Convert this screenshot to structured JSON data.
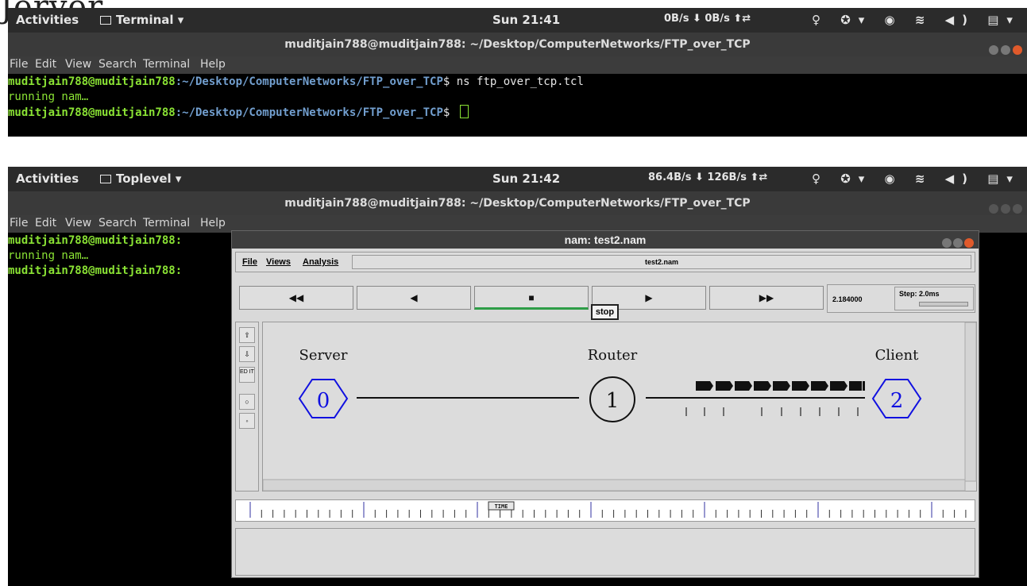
{
  "heading_fragment": "Jerver.",
  "shot1": {
    "topbar": {
      "activities": "Activities",
      "app": "Terminal ▾",
      "clock": "Sun 21:41",
      "net": "0B/s ⬇   0B/s ⬆⇄",
      "status_icons": "♀ ✪▾ ◉ ≋ ◀) ▤▾"
    },
    "window_title": "muditjain788@muditjain788: ~/Desktop/ComputerNetworks/FTP_over_TCP",
    "menu": [
      "File",
      "Edit",
      "View",
      "Search",
      "Terminal",
      "Help"
    ],
    "terminal": {
      "user_host": "muditjain788@muditjain788",
      "path": ":~/Desktop/ComputerNetworks/FTP_over_TCP",
      "prompt": "$ ",
      "command": "ns ftp_over_tcp.tcl",
      "output": "running nam…"
    }
  },
  "shot2": {
    "topbar": {
      "activities": "Activities",
      "app": "Toplevel ▾",
      "clock": "Sun 21:42",
      "net": "86.4B/s ⬇  126B/s ⬆⇄",
      "status_icons": "♀ ✪▾ ◉ ≋ ◀) ▤▾"
    },
    "window_title": "muditjain788@muditjain788: ~/Desktop/ComputerNetworks/FTP_over_TCP",
    "menu": [
      "File",
      "Edit",
      "View",
      "Search",
      "Terminal",
      "Help"
    ],
    "terminal": {
      "user_host_clipped": "muditjain788@muditjain788:",
      "output": "running nam…"
    },
    "nam": {
      "title": "nam: test2.nam",
      "menu": [
        "File",
        "Views",
        "Analysis"
      ],
      "filename": "test2.nam",
      "controls": [
        "◀◀",
        "◀",
        "■",
        "▶",
        "▶▶"
      ],
      "tooltip": "stop",
      "time_value": "2.184000",
      "step_label": "Step: 2.0ms",
      "tools": [
        "⇧",
        "⇩",
        "ED IT",
        "○",
        "◦"
      ],
      "timeline_marker": "TIME",
      "nodes": [
        {
          "id": "0",
          "label": "Server"
        },
        {
          "id": "1",
          "label": "Router"
        },
        {
          "id": "2",
          "label": "Client"
        }
      ]
    }
  },
  "colors": {
    "prompt_user": "#8ae234",
    "prompt_path": "#729fcf",
    "node_blue": "#1010e0",
    "play_bar": "#2e9d47"
  }
}
